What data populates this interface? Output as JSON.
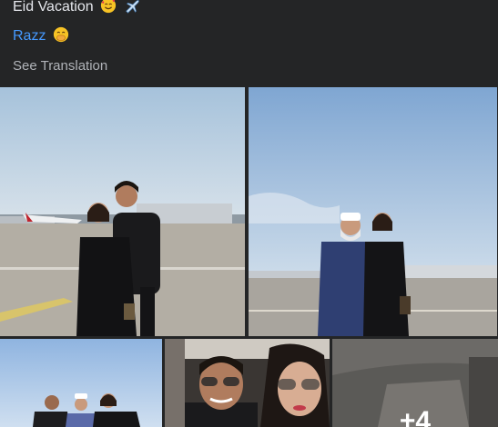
{
  "post": {
    "caption": "Eid Vacation",
    "tag_name": "Razz",
    "see_translation": "See Translation"
  },
  "icons": {
    "caption_emojis": [
      "smiling-face-with-hearts-icon",
      "airplane-icon"
    ],
    "tag_emoji": "hand-over-mouth-icon"
  },
  "colors": {
    "background": "#242526",
    "text": "#e4e6eb",
    "link": "#4599ff",
    "muted": "#b0b3b8"
  },
  "gallery": {
    "more_count": "+4"
  }
}
